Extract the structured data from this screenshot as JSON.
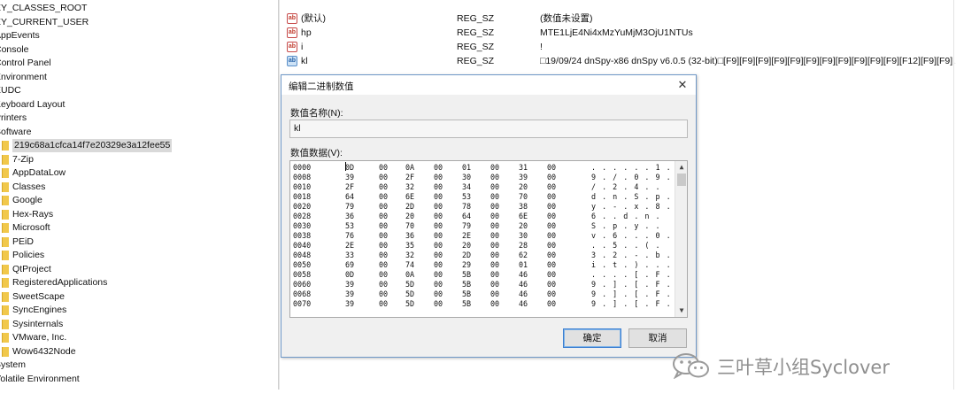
{
  "tree": {
    "root_items": [
      "EY_CLASSES_ROOT",
      "EY_CURRENT_USER",
      "AppEvents",
      "Console",
      "Control Panel",
      "Environment",
      "EUDC",
      "Keyboard Layout",
      "Printers",
      "Software"
    ],
    "software_children": [
      "219c68a1cfca14f7e20329e3a12fee55",
      "7-Zip",
      "AppDataLow",
      "Classes",
      "Google",
      "Hex-Rays",
      "Microsoft",
      "PEiD",
      "Policies",
      "QtProject",
      "RegisteredApplications",
      "SweetScape",
      "SyncEngines",
      "Sysinternals",
      "VMware, Inc.",
      "Wow6432Node"
    ],
    "after_items": [
      "System",
      "Volatile Environment"
    ],
    "selected": "219c68a1cfca14f7e20329e3a12fee55"
  },
  "values": [
    {
      "icon": "ab",
      "name": "(默认)",
      "type": "REG_SZ",
      "data": "(数值未设置)"
    },
    {
      "icon": "ab",
      "name": "hp",
      "type": "REG_SZ",
      "data": "MTE1LjE4Ni4xMzYuMjM3OjU1NTUs"
    },
    {
      "icon": "ab",
      "name": "i",
      "type": "REG_SZ",
      "data": "!"
    },
    {
      "icon": "ab",
      "name": "kl",
      "type": "REG_SZ",
      "data": "□19/09/24 dnSpy-x86 dnSpy v6.0.5 (32-bit)□[F9][F9][F9][F9][F9][F9][F9][F9][F9][F9][F9][F12][F9][F9]..."
    }
  ],
  "dialog": {
    "title": "编辑二进制数值",
    "close_glyph": "✕",
    "name_label": "数值名称(N):",
    "name_value": "kl",
    "data_label": "数值数据(V):",
    "hex_rows": [
      {
        "offset": "0000",
        "bytes": [
          "0D",
          "00",
          "0A",
          "00",
          "01",
          "00",
          "31",
          "00"
        ],
        "ascii": ". . . . . . 1 ."
      },
      {
        "offset": "0008",
        "bytes": [
          "39",
          "00",
          "2F",
          "00",
          "30",
          "00",
          "39",
          "00"
        ],
        "ascii": "9 . / . 0 . 9 ."
      },
      {
        "offset": "0010",
        "bytes": [
          "2F",
          "00",
          "32",
          "00",
          "34",
          "00",
          "20",
          "00"
        ],
        "ascii": "/ . 2 . 4 . ."
      },
      {
        "offset": "0018",
        "bytes": [
          "64",
          "00",
          "6E",
          "00",
          "53",
          "00",
          "70",
          "00"
        ],
        "ascii": "d . n . S . p ."
      },
      {
        "offset": "0020",
        "bytes": [
          "79",
          "00",
          "2D",
          "00",
          "78",
          "00",
          "38",
          "00"
        ],
        "ascii": "y . - . x . 8 ."
      },
      {
        "offset": "0028",
        "bytes": [
          "36",
          "00",
          "20",
          "00",
          "64",
          "00",
          "6E",
          "00"
        ],
        "ascii": "6 . . d . n ."
      },
      {
        "offset": "0030",
        "bytes": [
          "53",
          "00",
          "70",
          "00",
          "79",
          "00",
          "20",
          "00"
        ],
        "ascii": "S . p . y . ."
      },
      {
        "offset": "0038",
        "bytes": [
          "76",
          "00",
          "36",
          "00",
          "2E",
          "00",
          "30",
          "00"
        ],
        "ascii": "v . 6 . . . 0 ."
      },
      {
        "offset": "0040",
        "bytes": [
          "2E",
          "00",
          "35",
          "00",
          "20",
          "00",
          "28",
          "00"
        ],
        "ascii": ". . 5 . . ( ."
      },
      {
        "offset": "0048",
        "bytes": [
          "33",
          "00",
          "32",
          "00",
          "2D",
          "00",
          "62",
          "00"
        ],
        "ascii": "3 . 2 . - . b ."
      },
      {
        "offset": "0050",
        "bytes": [
          "69",
          "00",
          "74",
          "00",
          "29",
          "00",
          "01",
          "00"
        ],
        "ascii": "i . t . ) . . ."
      },
      {
        "offset": "0058",
        "bytes": [
          "0D",
          "00",
          "0A",
          "00",
          "5B",
          "00",
          "46",
          "00"
        ],
        "ascii": ". . . . [ . F ."
      },
      {
        "offset": "0060",
        "bytes": [
          "39",
          "00",
          "5D",
          "00",
          "5B",
          "00",
          "46",
          "00"
        ],
        "ascii": "9 . ] . [ . F ."
      },
      {
        "offset": "0068",
        "bytes": [
          "39",
          "00",
          "5D",
          "00",
          "5B",
          "00",
          "46",
          "00"
        ],
        "ascii": "9 . ] . [ . F ."
      },
      {
        "offset": "0070",
        "bytes": [
          "39",
          "00",
          "5D",
          "00",
          "5B",
          "00",
          "46",
          "00"
        ],
        "ascii": "9 . ] . [ . F ."
      }
    ],
    "scroll_up_glyph": "▲",
    "scroll_down_glyph": "▼",
    "ok_label": "确定",
    "cancel_label": "取消"
  },
  "watermark": {
    "text": "三叶草小组Syclover",
    "icon": "wechat-icon"
  },
  "colors": {
    "folder": "#f1c84b",
    "dialog_border": "#6f98c8",
    "selection": "#d9d9d9"
  }
}
